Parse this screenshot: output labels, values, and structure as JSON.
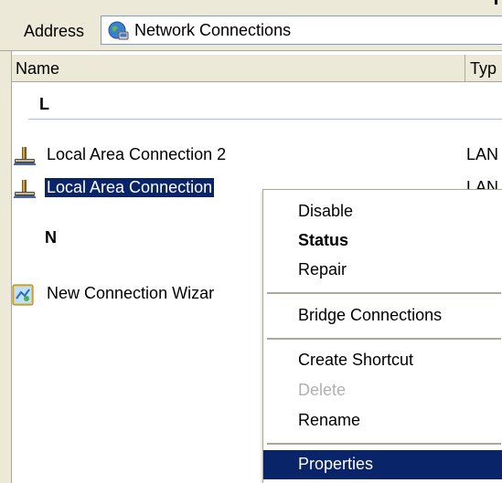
{
  "address_bar": {
    "label": "Address",
    "icon": "network-globe-icon",
    "value": "Network Connections"
  },
  "columns": [
    {
      "label": "Name"
    },
    {
      "label": "Typ"
    }
  ],
  "groups": [
    {
      "header": "L",
      "rows": [
        {
          "label": "Local Area Connection 2",
          "type": "LAN",
          "icon": "lan-connection-icon",
          "selected": false
        },
        {
          "label": "Local Area Connection",
          "type": "LAN",
          "icon": "lan-connection-icon",
          "selected": true
        }
      ]
    },
    {
      "header": "N",
      "rows": [
        {
          "label": "New Connection Wizar",
          "type": "",
          "icon": "new-connection-wizard-icon",
          "selected": false
        }
      ]
    }
  ],
  "context_menu": {
    "items": [
      {
        "label": "Disable",
        "style": "normal"
      },
      {
        "label": "Status",
        "style": "bold"
      },
      {
        "label": "Repair",
        "style": "normal"
      },
      {
        "separator": true
      },
      {
        "label": "Bridge Connections",
        "style": "normal"
      },
      {
        "separator": true
      },
      {
        "label": "Create Shortcut",
        "style": "normal"
      },
      {
        "label": "Delete",
        "style": "disabled"
      },
      {
        "label": "Rename",
        "style": "normal"
      },
      {
        "separator": true
      },
      {
        "label": "Properties",
        "style": "highlighted"
      }
    ]
  },
  "colors": {
    "selection": "#0a246a",
    "chrome": "#ece9d8",
    "border": "#aca899"
  }
}
